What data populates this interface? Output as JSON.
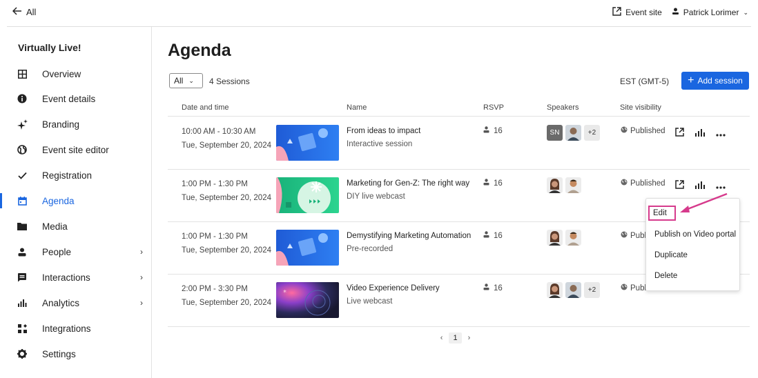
{
  "topbar": {
    "back_label": "All",
    "event_site_label": "Event site",
    "user_name": "Patrick Lorimer"
  },
  "sidebar": {
    "title": "Virtually Live!",
    "items": [
      {
        "label": "Overview"
      },
      {
        "label": "Event details"
      },
      {
        "label": "Branding"
      },
      {
        "label": "Event site editor"
      },
      {
        "label": "Registration"
      },
      {
        "label": "Agenda",
        "active": true
      },
      {
        "label": "Media"
      },
      {
        "label": "People",
        "chevron": true
      },
      {
        "label": "Interactions",
        "chevron": true
      },
      {
        "label": "Analytics",
        "chevron": true
      },
      {
        "label": "Integrations"
      },
      {
        "label": "Settings"
      }
    ]
  },
  "main": {
    "title": "Agenda",
    "filter_value": "All",
    "session_count": "4 Sessions",
    "timezone": "EST (GMT-5)",
    "add_session_label": "Add session",
    "columns": [
      "Date and time",
      "Name",
      "RSVP",
      "Speakers",
      "Site visibility"
    ],
    "rows": [
      {
        "time": "10:00 AM - 10:30 AM",
        "date": "Tue, September 20, 2024",
        "name": "From ideas to impact",
        "type": "Interactive session",
        "rsvp": "16",
        "speaker_initials": "SN",
        "speakers_more": "+2",
        "visibility": "Published"
      },
      {
        "time": "1:00 PM - 1:30 PM",
        "date": "Tue, September 20, 2024",
        "name": "Marketing for Gen-Z: The right way",
        "type": "DIY live webcast",
        "rsvp": "16",
        "visibility": "Published"
      },
      {
        "time": "1:00 PM - 1:30 PM",
        "date": "Tue, September 20, 2024",
        "name": "Demystifying Marketing Automation",
        "type": "Pre-recorded",
        "rsvp": "16",
        "visibility": "Publ"
      },
      {
        "time": "2:00 PM - 3:30 PM",
        "date": "Tue, September 20, 2024",
        "name": "Video Experience Delivery",
        "type": "Live webcast",
        "rsvp": "16",
        "speakers_more": "+2",
        "visibility": "Publ"
      }
    ],
    "page": "1"
  },
  "context_menu": {
    "items": [
      "Edit",
      "Publish on Video portal",
      "Duplicate",
      "Delete"
    ]
  },
  "colors": {
    "accent": "#1a66e0",
    "highlight": "#d63a8c"
  }
}
